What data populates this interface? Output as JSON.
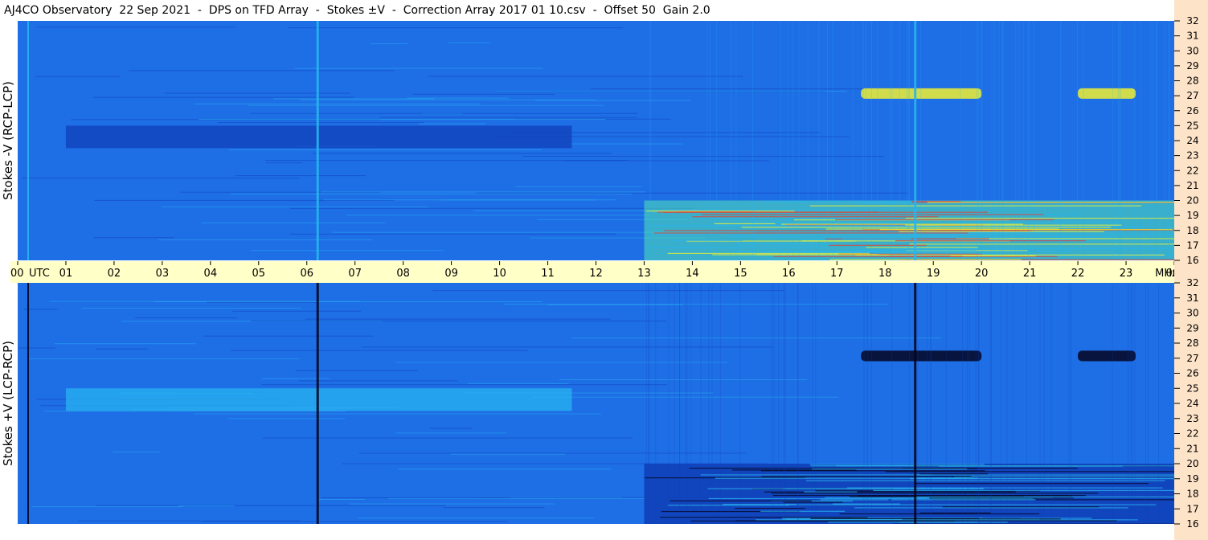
{
  "title": "AJ4CO Observatory  22 Sep 2021  -  DPS on TFD Array  -  Stokes ±V  -  Correction Array 2017 01 10.csv  -  Offset 50  Gain 2.0",
  "panels": {
    "top": {
      "label": "Stokes -V (RCP-LCP)",
      "polarity": "-V"
    },
    "bottom": {
      "label": "Stokes +V (LCP-RCP)",
      "polarity": "+V"
    }
  },
  "colors": {
    "background": "#1e6ee6",
    "dark": "#1040b8",
    "deep": "#050520",
    "light": "#28b4f0",
    "hot": "#f0f030",
    "warm": "#50e6b4",
    "time_axis_bg": "#ffffc8",
    "freq_axis_bg": "#fde3c8"
  },
  "chart_data": {
    "type": "heatmap",
    "x_unit": "UTC",
    "y_unit": "MHz",
    "x_ticks": [
      "00",
      "01",
      "02",
      "03",
      "04",
      "05",
      "06",
      "07",
      "08",
      "09",
      "10",
      "11",
      "12",
      "13",
      "14",
      "15",
      "16",
      "17",
      "18",
      "19",
      "20",
      "21",
      "22",
      "23",
      "00"
    ],
    "xlim": [
      0,
      24
    ],
    "y_ticks": [
      "32",
      "31",
      "30",
      "29",
      "28",
      "27",
      "26",
      "25",
      "24",
      "23",
      "22",
      "21",
      "20",
      "19",
      "18",
      "17",
      "16"
    ],
    "ylim": [
      16,
      32
    ],
    "features": [
      {
        "name": "daytime broadband noise",
        "x_range": [
          13,
          24
        ],
        "y_range": [
          16,
          20
        ]
      },
      {
        "name": "band at 27 MHz",
        "x_range": [
          17.5,
          20
        ],
        "y_range": [
          26.8,
          27.5
        ]
      },
      {
        "name": "band at 27 MHz",
        "x_range": [
          22,
          23.2
        ],
        "y_range": [
          26.8,
          27.5
        ]
      },
      {
        "name": "night band near 24 MHz",
        "x_range": [
          1,
          11.5
        ],
        "y_range": [
          23.5,
          25
        ]
      },
      {
        "name": "vertical line",
        "x_range": [
          6.2,
          6.25
        ],
        "y_range": [
          16,
          32
        ]
      },
      {
        "name": "vertical line",
        "x_range": [
          0.2,
          0.23
        ],
        "y_range": [
          16,
          32
        ]
      },
      {
        "name": "vertical line",
        "x_range": [
          18.6,
          18.65
        ],
        "y_range": [
          16,
          32
        ]
      }
    ]
  }
}
